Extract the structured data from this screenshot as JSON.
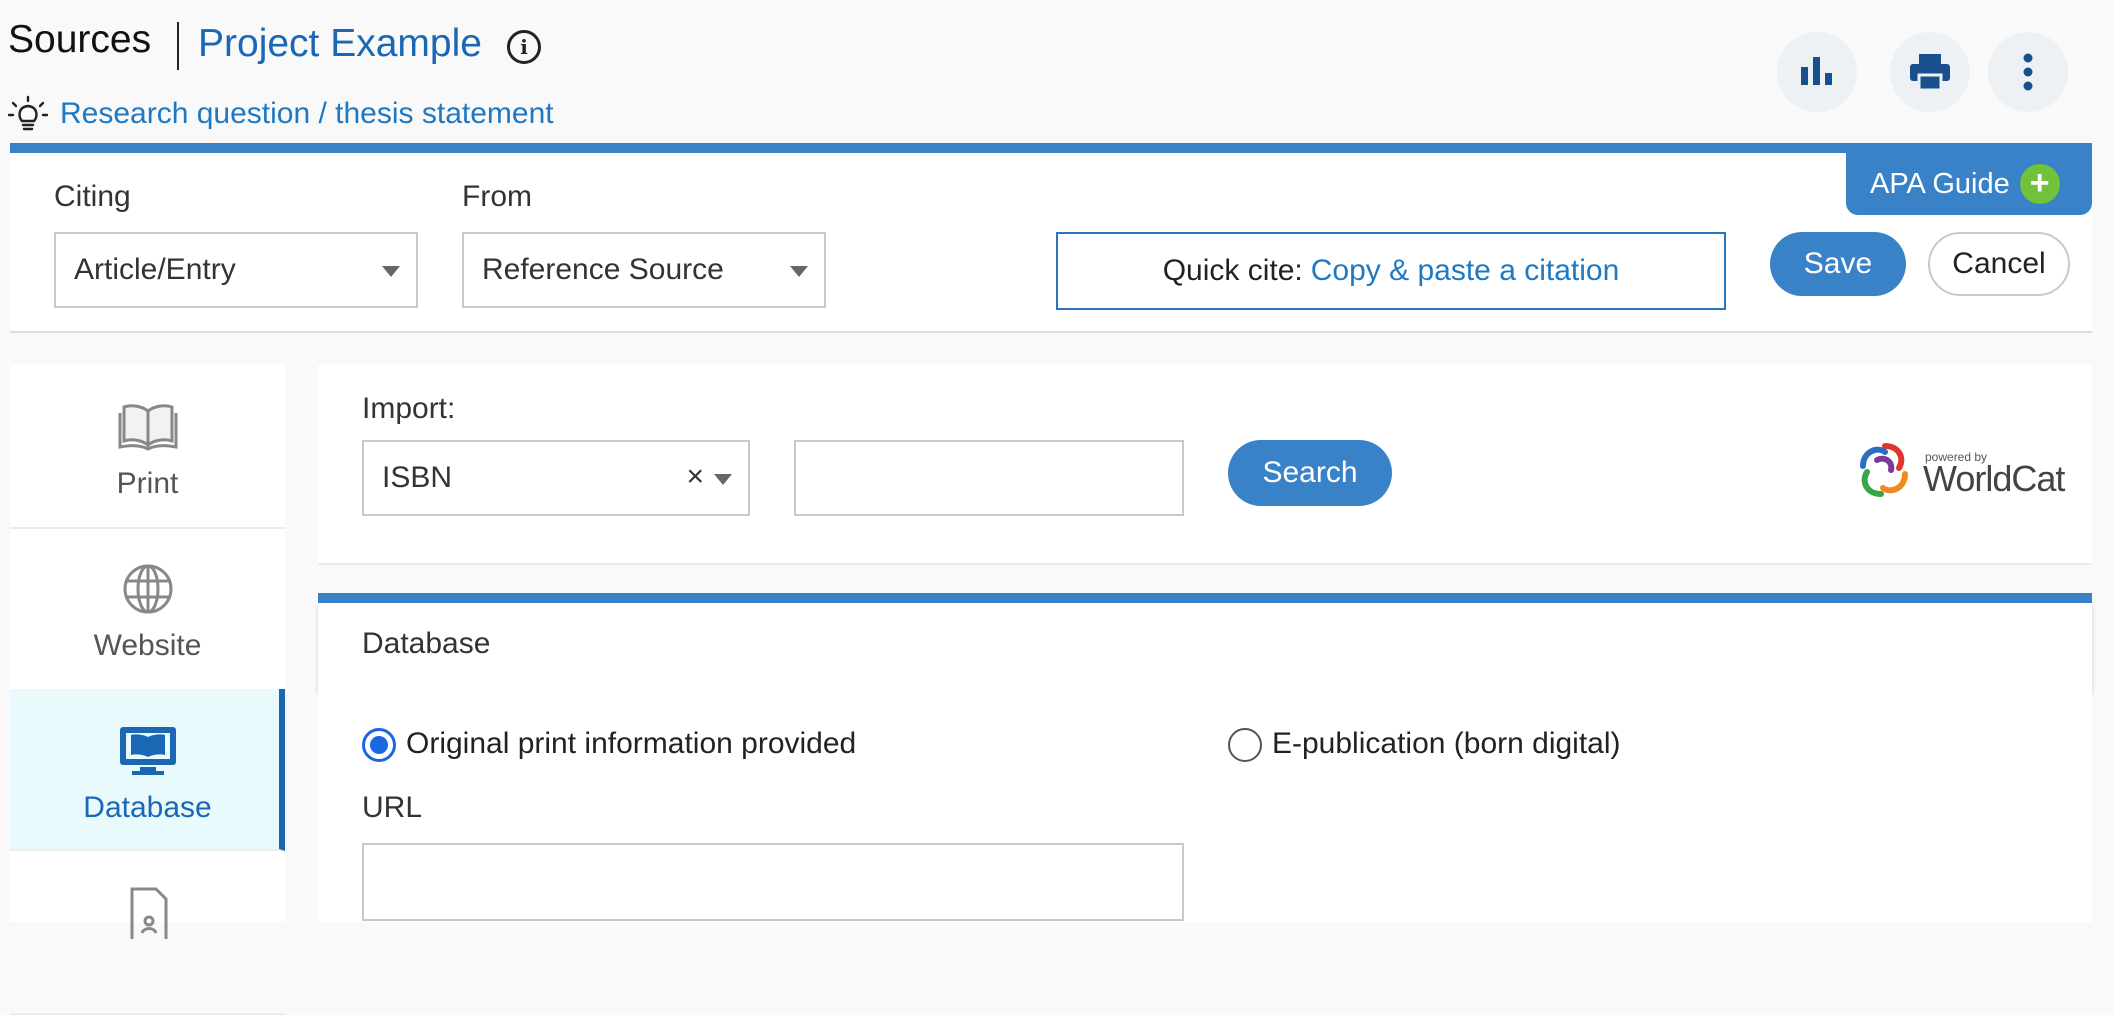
{
  "header": {
    "sources": "Sources",
    "project": "Project Example",
    "info_icon": "info-icon",
    "research_link": "Research question / thesis statement",
    "actions": [
      "bar-chart-icon",
      "printer-icon",
      "more-vertical-icon"
    ]
  },
  "citing": {
    "citing_label": "Citing",
    "citing_value": "Article/Entry",
    "from_label": "From",
    "from_value": "Reference Source",
    "quick_cite_prefix": "Quick cite:",
    "quick_cite_link": "Copy & paste a citation",
    "save": "Save",
    "cancel": "Cancel",
    "apa_guide": "APA Guide",
    "apa_plus": "+"
  },
  "sidebar": {
    "items": [
      {
        "label": "Print",
        "icon": "book-icon"
      },
      {
        "label": "Website",
        "icon": "globe-icon"
      },
      {
        "label": "Database",
        "icon": "monitor-book-icon",
        "active": true
      },
      {
        "label": "",
        "icon": "document-icon"
      }
    ]
  },
  "import": {
    "label": "Import:",
    "type_value": "ISBN",
    "clear": "×",
    "search_value": "",
    "search_button": "Search",
    "powered_by": "powered by",
    "worldcat": "WorldCat"
  },
  "database": {
    "title": "Database",
    "option1": "Original print information provided",
    "option2": "E-publication (born digital)",
    "selected": "option1",
    "url_label": "URL",
    "url_value": ""
  },
  "colors": {
    "accent": "#3a82c8",
    "link": "#1e78c2",
    "active_bg": "#e8fafc",
    "apa_plus": "#6fc23a"
  }
}
